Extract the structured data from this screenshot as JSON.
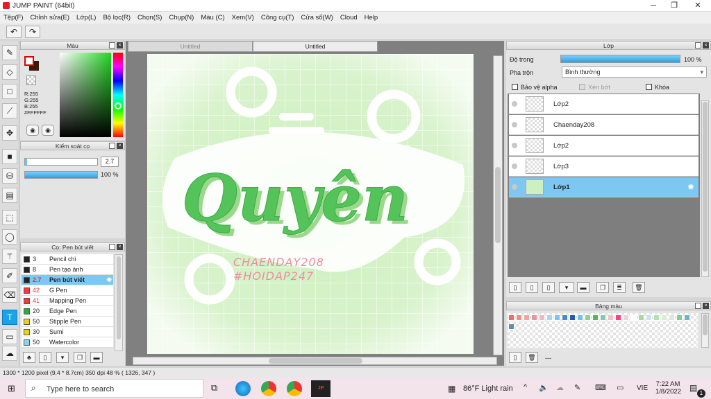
{
  "window": {
    "title": "JUMP PAINT (64bit)",
    "minimize": "─",
    "maximize": "❐",
    "close": "✕"
  },
  "menu": [
    "Tệp(F)",
    "Chỉnh sửa(E)",
    "Lớp(L)",
    "Bộ lọc(R)",
    "Chọn(S)",
    "Chụp(N)",
    "Màu (C)",
    "Xem(V)",
    "Công cụ(T)",
    "Cửa sổ(W)",
    "Cloud",
    "Help"
  ],
  "color_panel": {
    "title": "Màu",
    "r": "R:255",
    "g": "G:255",
    "b": "B:255",
    "hex": "#FFFFFF"
  },
  "brush_control": {
    "title": "Kiểm soát cọ",
    "size": "2.7",
    "opacity": "100 %"
  },
  "brush_list": {
    "title": "Cọ: Pen bút viết",
    "items": [
      {
        "size": "3",
        "name": "Pencil chì",
        "color": "#222222",
        "selected": false
      },
      {
        "size": "8",
        "name": "Pen tạo ảnh",
        "color": "#222222",
        "selected": false
      },
      {
        "size": "2.7",
        "name": "Pen bút viết",
        "color": "#222222",
        "selected": true
      },
      {
        "size": "42",
        "name": "G Pen",
        "color": "#ee3b3b",
        "selected": false
      },
      {
        "size": "41",
        "name": "Mapping Pen",
        "color": "#ee3b3b",
        "selected": false
      },
      {
        "size": "20",
        "name": "Edge Pen",
        "color": "#2eaa3a",
        "selected": false
      },
      {
        "size": "50",
        "name": "Stipple Pen",
        "color": "#e8d21a",
        "selected": false
      },
      {
        "size": "30",
        "name": "Sumi",
        "color": "#e8d21a",
        "selected": false
      },
      {
        "size": "50",
        "name": "Watercolor",
        "color": "#86d4f2",
        "selected": false
      }
    ]
  },
  "tabs": [
    "Untitled",
    "Untitled"
  ],
  "artwork": {
    "title": "Quyên",
    "line1": "CHAENDAY208",
    "line2": "#HOIDAP247"
  },
  "layer_panel": {
    "title": "Lớp",
    "opacity_label": "Độ trong",
    "opacity_value": "100 %",
    "blend_label": "Pha trộn",
    "blend_value": "Bình thường",
    "protect_alpha": "Bảo vệ alpha",
    "clipping": "Xén bớt",
    "lock": "Khóa",
    "layers": [
      {
        "name": "Lớp2",
        "selected": false
      },
      {
        "name": "Chaenday208",
        "selected": false
      },
      {
        "name": "Lớp2",
        "selected": false
      },
      {
        "name": "Lớp3",
        "selected": false
      },
      {
        "name": "Lớp1",
        "selected": true
      }
    ]
  },
  "palette": {
    "title": "Bảng màu",
    "more": "---",
    "colors": [
      "#f26b6b",
      "#f58a8a",
      "#f7a0a0",
      "#ef8fa6",
      "#f4b6c2",
      "#a6d8ef",
      "#7fc4ec",
      "#3b8fd6",
      "#1d5fb0",
      "#6ec2e8",
      "#8fd18f",
      "#5ab55a",
      "#89c7b4",
      "#f3c0cb",
      "#ff3f7f",
      "#e8d5d5",
      "#ffffff",
      "#a9d89b",
      "#cce3f2",
      "#b4e0b4",
      "#d7eed0",
      "#e2e2e2",
      "#7fcf8f",
      "#6fb3c9",
      "#5e8fb7"
    ]
  },
  "status": "1300 * 1200 pixel  (9.4 * 8.7cm)  350 dpi  48 %  ( 1326, 347 )",
  "taskbar": {
    "search": "Type here to search",
    "weather": "86°F  Light rain",
    "lang": "VIE",
    "time": "7:22 AM",
    "date": "1/8/2022",
    "notif": "1"
  }
}
